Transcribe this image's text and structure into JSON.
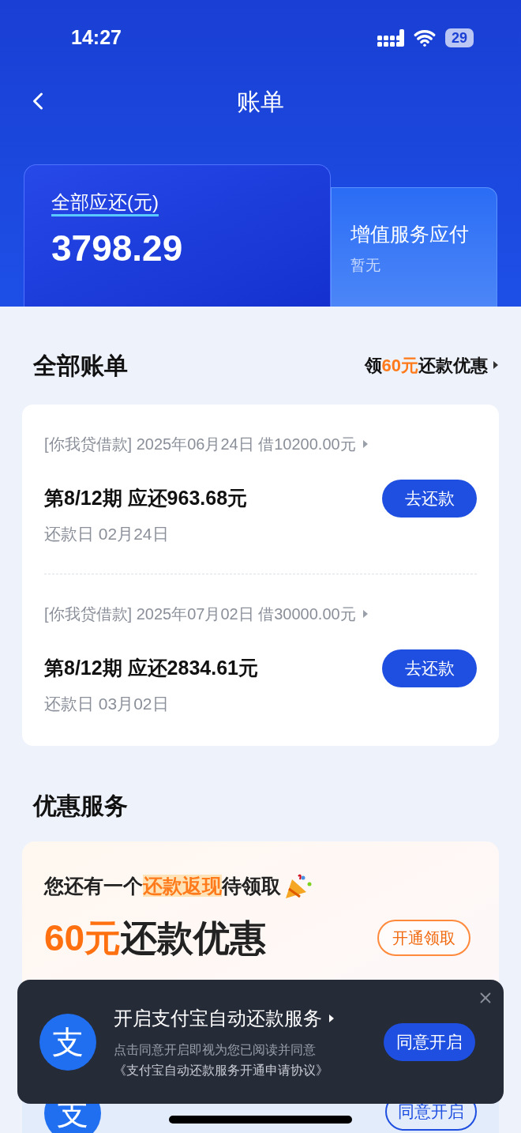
{
  "status_bar": {
    "time": "14:27",
    "battery": "29"
  },
  "nav": {
    "title": "账单"
  },
  "summary": {
    "label": "全部应还(元)",
    "amount": "3798.29",
    "side_title": "增值服务应付",
    "side_value": "暂无"
  },
  "bills_section": {
    "title": "全部账单",
    "promo_prefix": "领",
    "promo_highlight": "60元",
    "promo_suffix": "还款优惠"
  },
  "bills": [
    {
      "loan_info": "[你我贷借款] 2025年06月24日 借10200.00元",
      "installment": "第8/12期 应还963.68元",
      "due": "还款日 02月24日",
      "button": "去还款"
    },
    {
      "loan_info": "[你我贷借款] 2025年07月02日 借30000.00元",
      "installment": "第8/12期 应还2834.61元",
      "due": "还款日 03月02日",
      "button": "去还款"
    }
  ],
  "offers": {
    "title": "优惠服务",
    "line_prefix": "您还有一个",
    "line_highlight": "还款返现",
    "line_suffix": "待领取",
    "headline_amount": "60元",
    "headline_rest": "还款优惠",
    "button": "开通领取",
    "behind_logo": "支",
    "behind_button": "同意开启"
  },
  "toast": {
    "logo": "支",
    "title": "开启支付宝自动还款服务",
    "note": "点击同意开启即视为您已阅读并同意",
    "link": "《支付宝自动还款服务开通申请协议》",
    "button": "同意开启"
  }
}
